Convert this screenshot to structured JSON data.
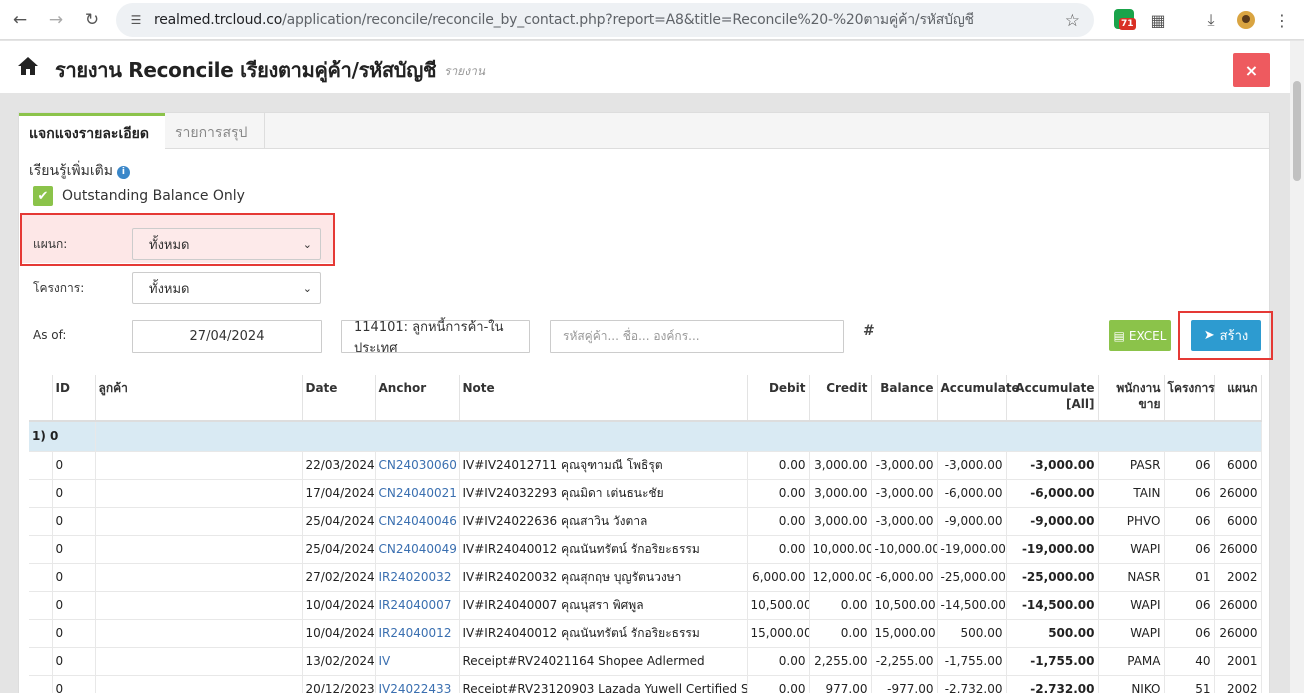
{
  "browser": {
    "url_host": "realmed.trcloud.co",
    "url_path": "/application/reconcile/reconcile_by_contact.php?report=A8&title=Reconcile%20-%20ตามคู่ค้า/รหัสบัญชี",
    "ext_badge": "71"
  },
  "header": {
    "title": "รายงาน Reconcile เรียงตามคู่ค้า/รหัสบัญชี",
    "subtitle": "รายงาน",
    "close": "×"
  },
  "tabs": {
    "detail": "แจกแจงรายละเอียด",
    "summary": "รายการสรุป"
  },
  "filters": {
    "learn_more": "เรียนรู้เพิ่มเติม",
    "outstanding_label": "Outstanding Balance Only",
    "dept_label": "แผนก:",
    "dept_value": "ทั้งหมด",
    "project_label": "โครงการ:",
    "project_value": "ทั้งหมด",
    "asof_label": "As of:",
    "asof_value": "27/04/2024",
    "account_value": "114101: ลูกหนี้การค้า-ในประเทศ",
    "contact_placeholder": "รหัสคู่ค้า... ชื่อ... องค์กร...",
    "hash": "#",
    "excel": "EXCEL",
    "create": "สร้าง"
  },
  "table": {
    "headers": [
      "",
      "ID",
      "ลูกค้า",
      "Date",
      "Anchor",
      "Note",
      "Debit",
      "Credit",
      "Balance",
      "Accumulate",
      "Accumulate [All]",
      "พนักงานขาย",
      "โครงการ",
      "แผนก"
    ],
    "group_label": "1) 0",
    "rows": [
      [
        "0",
        "",
        "22/03/2024",
        "CN24030060",
        "IV#IV24012711 คุณจุฑามณี โพธิรุต",
        "0.00",
        "3,000.00",
        "-3,000.00",
        "-3,000.00",
        "-3,000.00",
        "PASR",
        "06",
        "6000"
      ],
      [
        "0",
        "",
        "17/04/2024",
        "CN24040021",
        "IV#IV24032293 คุณมิดา เต่นธนะชัย",
        "0.00",
        "3,000.00",
        "-3,000.00",
        "-6,000.00",
        "-6,000.00",
        "TAIN",
        "06",
        "26000"
      ],
      [
        "0",
        "",
        "25/04/2024",
        "CN24040046",
        "IV#IV24022636 คุณสาวิน วังตาล",
        "0.00",
        "3,000.00",
        "-3,000.00",
        "-9,000.00",
        "-9,000.00",
        "PHVO",
        "06",
        "6000"
      ],
      [
        "0",
        "",
        "25/04/2024",
        "CN24040049",
        "IV#IR24040012 คุณนันทรัตน์ รักอริยะธรรม",
        "0.00",
        "10,000.00",
        "-10,000.00",
        "-19,000.00",
        "-19,000.00",
        "WAPI",
        "06",
        "26000"
      ],
      [
        "0",
        "",
        "27/02/2024",
        "IR24020032",
        "IV#IR24020032 คุณสุกฤษ บุญรัตนวงษา",
        "6,000.00",
        "12,000.00",
        "-6,000.00",
        "-25,000.00",
        "-25,000.00",
        "NASR",
        "01",
        "2002"
      ],
      [
        "0",
        "",
        "10/04/2024",
        "IR24040007",
        "IV#IR24040007 คุณนุสรา พิศพูล",
        "10,500.00",
        "0.00",
        "10,500.00",
        "-14,500.00",
        "-14,500.00",
        "WAPI",
        "06",
        "26000"
      ],
      [
        "0",
        "",
        "10/04/2024",
        "IR24040012",
        "IV#IR24040012 คุณนันทรัตน์ รักอริยะธรรม",
        "15,000.00",
        "0.00",
        "15,000.00",
        "500.00",
        "500.00",
        "WAPI",
        "06",
        "26000"
      ],
      [
        "0",
        "",
        "13/02/2024",
        "IV",
        "Receipt#RV24021164 Shopee Adlermed",
        "0.00",
        "2,255.00",
        "-2,255.00",
        "-1,755.00",
        "-1,755.00",
        "PAMA",
        "40",
        "2001"
      ],
      [
        "0",
        "",
        "20/12/2023",
        "IV24022433",
        "Receipt#RV23120903 Lazada Yuwell Certified Store",
        "0.00",
        "977.00",
        "-977.00",
        "-2,732.00",
        "-2,732.00",
        "NIKO",
        "51",
        "2002"
      ]
    ]
  },
  "colors": {
    "accent_green": "#8bc34a",
    "primary_blue": "#2d9bd0",
    "danger_red": "#ee5a5f",
    "highlight_red": "#e53935"
  }
}
